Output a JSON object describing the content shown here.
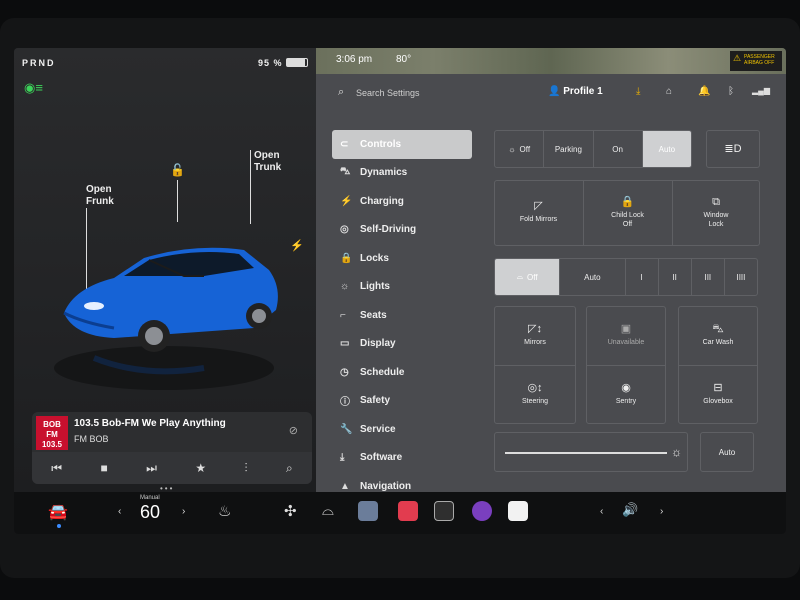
{
  "status": {
    "gear": "PRND",
    "battery": "95 %"
  },
  "car": {
    "open_frunk": "Open\nFrunk",
    "open_trunk": "Open\nTrunk"
  },
  "media": {
    "logo": "BOB\nFM\n103.5",
    "track": "103.5 Bob-FM We Play Anything",
    "station": "FM BOB",
    "controls": [
      "⏮",
      "■",
      "⏭",
      "★",
      "⫶",
      "⌕"
    ]
  },
  "map": {
    "time": "3:06 pm",
    "temp": "80°",
    "airbag": "PASSENGER AIRBAG OFF"
  },
  "settings_header": {
    "search_placeholder": "Search Settings",
    "profile": "Profile 1"
  },
  "menu": [
    {
      "label": "Controls",
      "icon": "toggle-icon",
      "glyph": "⊂",
      "active": true
    },
    {
      "label": "Dynamics",
      "icon": "car-icon",
      "glyph": "⛍"
    },
    {
      "label": "Charging",
      "icon": "bolt-icon",
      "glyph": "⚡"
    },
    {
      "label": "Self-Driving",
      "icon": "steering-wheel-icon",
      "glyph": "◎"
    },
    {
      "label": "Locks",
      "icon": "lock-icon",
      "glyph": "🔒"
    },
    {
      "label": "Lights",
      "icon": "light-icon",
      "glyph": "☼"
    },
    {
      "label": "Seats",
      "icon": "seat-icon",
      "glyph": "⌐"
    },
    {
      "label": "Display",
      "icon": "display-icon",
      "glyph": "▭"
    },
    {
      "label": "Schedule",
      "icon": "clock-icon",
      "glyph": "◷"
    },
    {
      "label": "Safety",
      "icon": "safety-icon",
      "glyph": "ⓘ"
    },
    {
      "label": "Service",
      "icon": "wrench-icon",
      "glyph": "🔧"
    },
    {
      "label": "Software",
      "icon": "download-icon",
      "glyph": "⤓"
    },
    {
      "label": "Navigation",
      "icon": "navigation-icon",
      "glyph": "▲"
    }
  ],
  "lights": {
    "options": [
      "Off",
      "Parking",
      "On",
      "Auto"
    ],
    "selected": "Auto"
  },
  "tiles_row1": {
    "fold_mirrors": "Fold Mirrors",
    "child_lock": "Child Lock\nOff",
    "window_lock": "Window\nLock"
  },
  "wipers": {
    "options": [
      "Off",
      "Auto",
      "I",
      "II",
      "III",
      "IIII"
    ],
    "selected": "Off"
  },
  "tiles_grid": {
    "mirrors": "Mirrors",
    "unavailable": "Unavailable",
    "car_wash": "Car Wash",
    "steering": "Steering",
    "sentry": "Sentry",
    "glovebox": "Glovebox"
  },
  "brightness": {
    "level": 0.85,
    "auto_label": "Auto"
  },
  "bottom_bar": {
    "temp_mode": "Manual",
    "temp_value": "60"
  }
}
